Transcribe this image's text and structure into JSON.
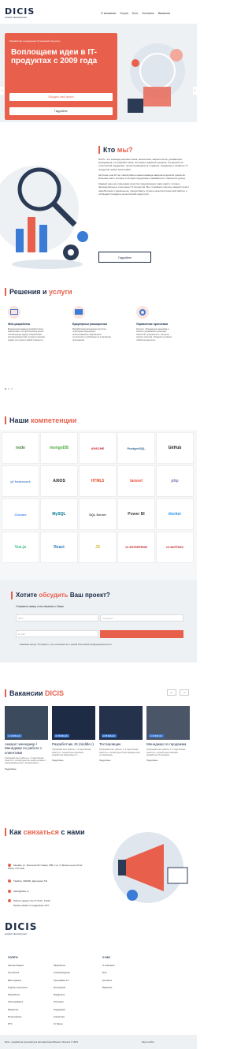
{
  "header": {
    "logo": "DICIS",
    "logo_sub": "product development",
    "nav": [
      "О компании",
      "Услуги",
      "Блог",
      "Контакты",
      "Вакансии"
    ]
  },
  "hero": {
    "small": "Разработка и внедрение IT-решений под ключ",
    "title": "Воплощаем идеи в IT-продуктах с 2009 года",
    "btn_primary": "Обсудить свой проект",
    "btn_secondary": "Подробнее"
  },
  "who": {
    "title_a": "Кто ",
    "title_b": "мы?",
    "p1": "DICIS - это команда разработчиков, аналитиков, маркетологов, дизайнеров, менеджеров, 1С разработчиков, системных администраторов, специалистов технической поддержки, ориентированная на создание, поддержку и развитие IT-продуктов любых масштабов.",
    "p2": "За более чем 10 лет своей работы наша команда закрепила десятки проектов. Большая часть которых и сегодня продолжает развиваться и приносить доход.",
    "p3": "Каждый день мы повышаем качество предлагаемых нами идей и готовых, функциональных и выгодных IT-продуктов. Мы стремимся сделать каждый проект самобытным и уникальным, предоставить лучшее качество проектной работы и соблюдая стандарты качества веб-индустрии.",
    "btn": "Подробнее"
  },
  "solutions": {
    "title_a": "Решения и ",
    "title_b": "услуги",
    "items": [
      {
        "name": "Web-разработка",
        "desc": "Выделенная команда разработчиков, аналитиков и UX архитекторов решит поставленную задачу. Разработаем корпоративный сайт, интернет-магазин, сервис или портал любой сложности."
      },
      {
        "name": "Браузерные расширения",
        "desc": "Разработаем расширения для всех популярных браузеров с использованием современных технологий и опубликуем их в магазинах приложений."
      },
      {
        "name": "Управление проектами",
        "desc": "Коллеги, обладающие знаниями в области управления проектами, обеспечат прозрачность, контроль сроков, качества и бюджета в рамках гибкой методологии."
      }
    ]
  },
  "competencies": {
    "title_a": "Наши ",
    "title_b": "компетенции",
    "logos": [
      "node",
      "mongoDB",
      "APACHE",
      "PostgreSQL",
      "GitHub",
      "yii framework",
      "AXIOS",
      "HTML5",
      "laravel",
      "php",
      "Chrome",
      "MySQL",
      "SQL Server",
      "Power BI",
      "docker",
      "Vue.js",
      "React",
      "JS",
      "1C:ENTERPRISE",
      "1С-БИТРИКС"
    ]
  },
  "form": {
    "title_a": "Хотите ",
    "title_b": "обсудить",
    "title_c": " Ваш проект?",
    "sub": "Отправьте заявку и мы свяжемся с Вами",
    "name_ph": "Имя*",
    "phone_ph": "Телефон*",
    "email_ph": "E-mail",
    "note": "Нажимая кнопку \"Отправить\", вы соглашаетесь с нашей Политикой конфиденциальности"
  },
  "vacancies": {
    "title_a": "Вакансии ",
    "title_b": "DICIS",
    "items": [
      {
        "salary": "от 40 000 руб.",
        "title": "Аккаунт менеджер / Менеджер по работе с клиентами",
        "desc": "Требуемый опыт работы: 1–3 года Полная занятость, полный день Мы ищем активного, коммуникабельного и инициативного...",
        "more": "Подробнее"
      },
      {
        "salary": "от 70 000 руб.",
        "title": "Разработчик JS (middle+)",
        "desc": "Требуемый опыт работы: 1–3 года Полная занятость, полный день Компания разработчик браузерных IT-...",
        "more": "Подробнее"
      },
      {
        "salary": "от 35 000 руб.",
        "title": "Тестировщик",
        "desc": "Требуемый опыт работы: 1–3 года Полная занятость, полный день Наша команда ищет тестировщика...",
        "more": "Подробнее"
      },
      {
        "salary": "от 30 000 руб.",
        "title": "Менеджер по продажам",
        "desc": "Требуемый опыт работы: 1–3 года Полная занятость, полный день Компания разработчик IT-решений...",
        "more": "Подробнее"
      }
    ]
  },
  "contacts": {
    "title_a": "Как ",
    "title_b": "связаться",
    "title_c": " с нами",
    "addr1": "Москва, ул. Большая Почтовая, 26В, стр. 2, Бизнес-центр Post Plaza, 3-й этаж",
    "addr2": "Тамбов, 392000, Дорожная 7к2",
    "email": "sales@dicis.ru",
    "hours1": "Работа офиса: Пн-Пт 9:00 - 19:00",
    "hours2": "Прием заявок и поддержка: 24/7"
  },
  "footer": {
    "logo": "DICIS",
    "logo_sub": "product development",
    "head1": "УСЛУГИ",
    "head2": "О НАС",
    "col1": [
      "Автоматизация",
      "Аутсорсинг",
      "Веб-сервисы",
      "Подбор персонала",
      "Разработка",
      "Обслуживание",
      "Маркетинг",
      "Монетизация",
      "ИТС"
    ],
    "col2": [
      "Разработка",
      "Сопровождение",
      "Программы 1С",
      "Интеграция",
      "Внедрение",
      "Обучение",
      "Поддержка",
      "Аналитика",
      "1С Фреш"
    ],
    "col3": [
      "О компании",
      "Блог",
      "Контакты",
      "Вакансии"
    ],
    "copyright": "Dicis - разработка решений для автоматизации Вашего бизнеса © 2021",
    "sitemap": "Карта сайта"
  }
}
